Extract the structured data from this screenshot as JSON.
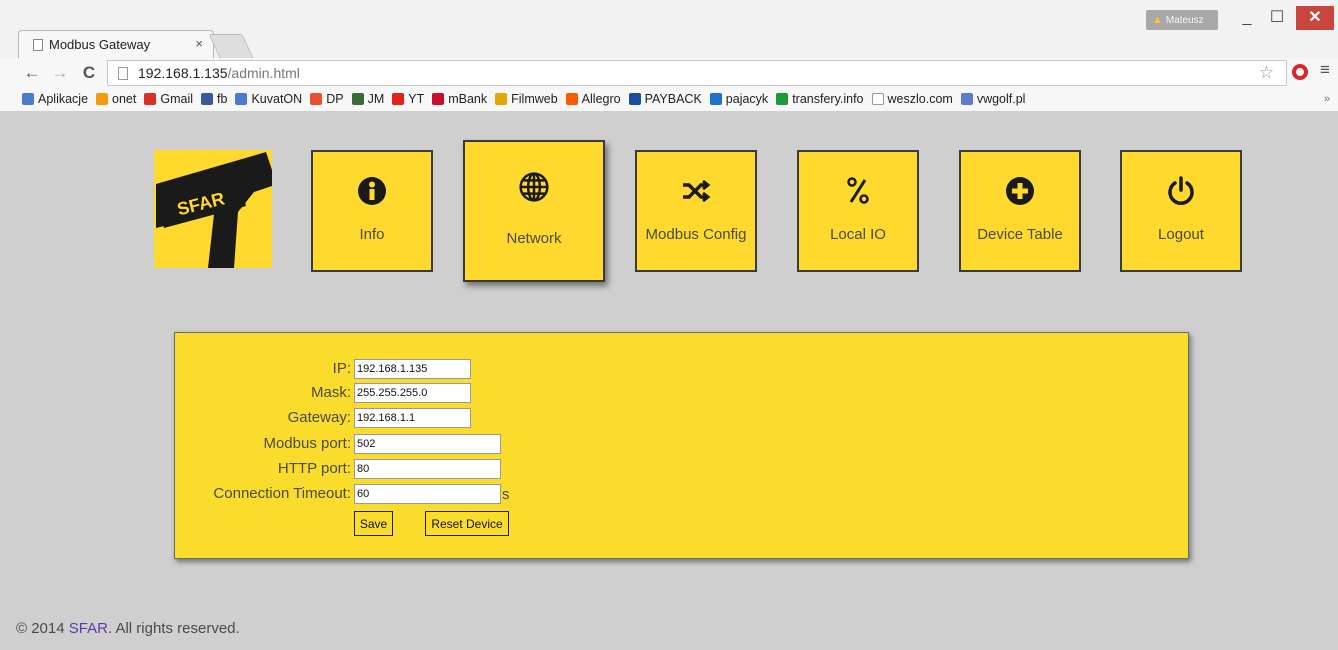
{
  "browser": {
    "tab_title": "Modbus Gateway",
    "tab_close": "×",
    "user_name": "Mateusz",
    "url_host": "192.168.1.135",
    "url_path": "/admin.html",
    "bookmarks": [
      {
        "label": "Aplikacje",
        "icon": "apps-grid-icon",
        "color": "#4a7bd0"
      },
      {
        "label": "onet",
        "icon": "onet-icon",
        "color": "#f39c12"
      },
      {
        "label": "Gmail",
        "icon": "gmail-icon",
        "color": "#d93025"
      },
      {
        "label": "fb",
        "icon": "facebook-icon",
        "color": "#3b5998"
      },
      {
        "label": "KuvatON",
        "icon": "kuvaton-icon",
        "color": "#4a7bd0"
      },
      {
        "label": "DP",
        "icon": "dp-icon",
        "color": "#e8502f"
      },
      {
        "label": "JM",
        "icon": "jm-icon",
        "color": "#3a6b3a"
      },
      {
        "label": "YT",
        "icon": "youtube-icon",
        "color": "#e62117"
      },
      {
        "label": "mBank",
        "icon": "mbank-icon",
        "color": "#c8102e"
      },
      {
        "label": "Filmweb",
        "icon": "filmweb-icon",
        "color": "#e0a800"
      },
      {
        "label": "Allegro",
        "icon": "allegro-icon",
        "color": "#ff5a00"
      },
      {
        "label": "PAYBACK",
        "icon": "payback-icon",
        "color": "#1a4f9c"
      },
      {
        "label": "pajacyk",
        "icon": "pajacyk-icon",
        "color": "#1f6fd1"
      },
      {
        "label": "transfery.info",
        "icon": "transfery-icon",
        "color": "#1a9b3a"
      },
      {
        "label": "weszlo.com",
        "icon": "page-icon",
        "color": "#ffffff"
      },
      {
        "label": "vwgolf.pl",
        "icon": "vw-icon",
        "color": "#5a7bd0"
      }
    ],
    "bookmarks_more": "»"
  },
  "nav": [
    {
      "label": "Info",
      "icon": "info-icon"
    },
    {
      "label": "Network",
      "icon": "globe-icon",
      "active": true
    },
    {
      "label": "Modbus Config",
      "icon": "shuffle-icon"
    },
    {
      "label": "Local IO",
      "icon": "percent-icon"
    },
    {
      "label": "Device Table",
      "icon": "plus-circle-icon"
    },
    {
      "label": "Logout",
      "icon": "power-icon"
    }
  ],
  "logo_text": "SFAR",
  "form": {
    "ip_label": "IP:",
    "ip_value": "192.168.1.135",
    "mask_label": "Mask:",
    "mask_value": "255.255.255.0",
    "gateway_label": "Gateway:",
    "gateway_value": "192.168.1.1",
    "modbus_port_label": "Modbus port:",
    "modbus_port_value": "502",
    "http_port_label": "HTTP port:",
    "http_port_value": "80",
    "timeout_label": "Connection Timeout:",
    "timeout_value": "60",
    "timeout_unit": "s",
    "save_label": "Save",
    "reset_label": "Reset Device"
  },
  "footer": {
    "prefix": "© 2014 ",
    "brand": "SFAR",
    "suffix": ". All rights reserved."
  },
  "colors": {
    "accent_yellow": "#ffd92e",
    "panel_yellow": "#fadd2c",
    "page_bg": "#cfcfcf",
    "brand_link": "#5b3aa6"
  }
}
